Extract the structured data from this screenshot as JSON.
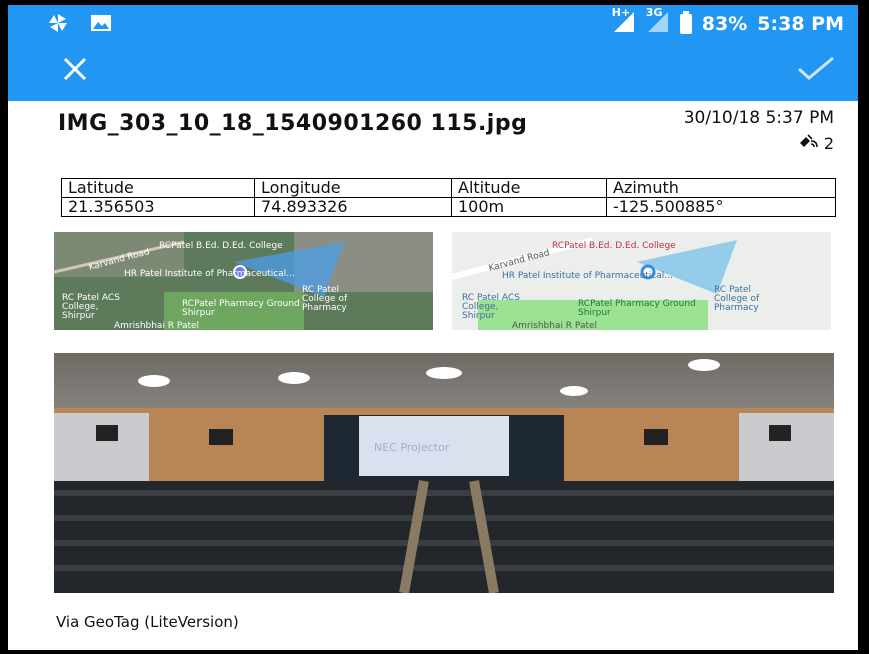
{
  "status": {
    "network_left": "H+",
    "network_right": "3G",
    "battery": "83%",
    "time": "5:38 PM"
  },
  "icons": {
    "close": "close-icon",
    "confirm": "check-icon"
  },
  "photo_info": {
    "filename": "IMG_303_10_18_1540901260 115.jpg",
    "datetime": "30/10/18 5:37 PM",
    "satellites": "2"
  },
  "geo_table": {
    "headers": [
      "Latitude",
      "Longitude",
      "Altitude",
      "Azimuth"
    ],
    "values": [
      "21.356503",
      "74.893326",
      "100m",
      "-125.500885°"
    ]
  },
  "maps": {
    "road_labels": [
      "RCPatel B.Ed. D.Ed. College",
      "HR Patel Institute of Pharmaceutical...",
      "RC Patel ACS College, Shirpur",
      "RCPatel Pharmacy Ground Shirpur",
      "RC Patel College of Pharmacy",
      "Amrishbhai R Patel",
      "Karvand Road"
    ],
    "satellite_labels": [
      "RCPatel B.Ed. D.Ed. College",
      "HR Patel Institute of Pharmaceutical...",
      "RC Patel ACS College, Shirpur",
      "RCPatel Pharmacy Ground Shirpur",
      "RC Patel College of Pharmacy",
      "Amrishbhai R Patel",
      "Karvand Road"
    ]
  },
  "projector_text": "NEC Projector",
  "footer": "Via GeoTag (LiteVersion)"
}
